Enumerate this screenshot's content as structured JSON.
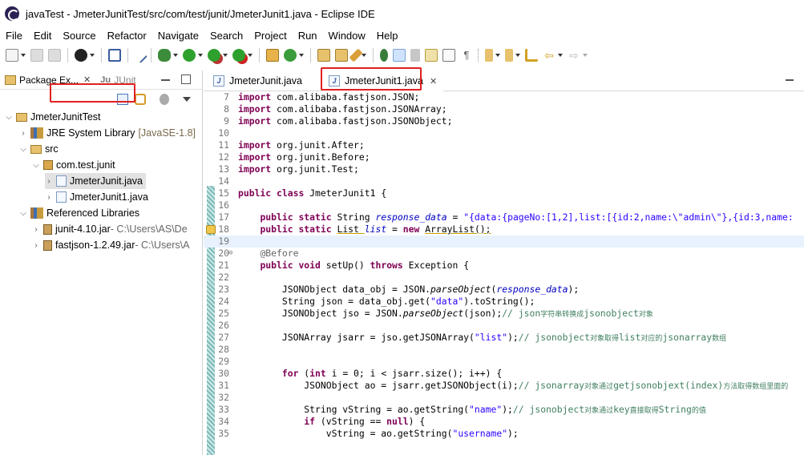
{
  "window": {
    "title": "javaTest - JmeterJunitTest/src/com/test/junit/JmeterJunit1.java - Eclipse IDE"
  },
  "menu": [
    "File",
    "Edit",
    "Source",
    "Refactor",
    "Navigate",
    "Search",
    "Project",
    "Run",
    "Window",
    "Help"
  ],
  "left_tabs": {
    "package_explorer": "Package Ex...",
    "junit": "JUnit"
  },
  "tree": {
    "project": "JmeterJunitTest",
    "jre": "JRE System Library",
    "jre_version": "[JavaSE-1.8]",
    "src": "src",
    "package": "com.test.junit",
    "file1": "JmeterJunit.java",
    "file2": "JmeterJunit1.java",
    "ref_libs": "Referenced Libraries",
    "lib1": "junit-4.10.jar",
    "lib1_path": " - C:\\Users\\AS\\De",
    "lib2": "fastjson-1.2.49.jar",
    "lib2_path": " - C:\\Users\\A"
  },
  "editor_tabs": [
    "JmeterJunit.java",
    "JmeterJunit1.java"
  ],
  "code_lines": [
    {
      "n": "7"
    },
    {
      "n": "8"
    },
    {
      "n": "9"
    },
    {
      "n": "10"
    },
    {
      "n": "11"
    },
    {
      "n": "12"
    },
    {
      "n": "13"
    },
    {
      "n": "14"
    },
    {
      "n": "15"
    },
    {
      "n": "16"
    },
    {
      "n": "17"
    },
    {
      "n": "18"
    },
    {
      "n": "19"
    },
    {
      "n": "20"
    },
    {
      "n": "21"
    },
    {
      "n": "22"
    },
    {
      "n": "23"
    },
    {
      "n": "24"
    },
    {
      "n": "25"
    },
    {
      "n": "26"
    },
    {
      "n": "27"
    },
    {
      "n": "28"
    },
    {
      "n": "29"
    },
    {
      "n": "30"
    },
    {
      "n": "31"
    },
    {
      "n": "32"
    },
    {
      "n": "33"
    },
    {
      "n": "34"
    },
    {
      "n": "35"
    }
  ],
  "code": {
    "import_json": "com.alibaba.fastjson.JSON;",
    "import_jsonarray": "com.alibaba.fastjson.JSONArray;",
    "import_jsonobject": "com.alibaba.fastjson.JSONObject;",
    "import_after": "org.junit.After;",
    "import_before": "org.junit.Before;",
    "import_test": "org.junit.Test;",
    "class_name": "JmeterJunit1 {",
    "field1_name": "response_data",
    "field1_value": "\"{data:{pageNo:[1,2],list:[{id:2,name:\\\"admin\\\"},{id:3,name:",
    "field2_name": "list",
    "field2_rest": " = ",
    "annotation": "@Before",
    "setup": "setUp() ",
    "setup_rest": " Exception {",
    "l23_a": "JSONObject data_obj = JSON.",
    "l23_m": "parseObject",
    "l23_b": "(",
    "l23_c": ");",
    "l24_a": "String json = data_obj.get(",
    "l24_s": "\"data\"",
    "l24_b": ").toString();",
    "l25_a": "JSONObject jso = JSON.",
    "l25_m": "parseObject",
    "l25_b": "(json);",
    "l25_c": "// json",
    "l25_cn": "字符串转换成",
    "l25_d": "jsonobject",
    "l25_cn2": "对象",
    "l27_a": "JSONArray jsarr = jso.getJSONArray(",
    "l27_s": "\"list\"",
    "l27_b": ");",
    "l27_c": "// jsonobject",
    "l27_cn": "对象取得",
    "l27_d": "list",
    "l27_cn2": "对应的",
    "l27_e": "jsonarray",
    "l27_cn3": "数组",
    "l30_a": " (",
    "l30_b": " i = 0; i < jsarr.size(); i++) {",
    "l31_a": "JSONObject ao = jsarr.getJSONObject(i);",
    "l31_c": "// jsonarray",
    "l31_cn": "对象通过",
    "l31_d": "getjsonobjext(index)",
    "l31_cn2": "方法取得数组里面的",
    "l33_a": "String vString = ao.getString(",
    "l33_s": "\"name\"",
    "l33_b": ");",
    "l33_c": "// jsonobject",
    "l33_cn": "对象通过",
    "l33_d": "key",
    "l33_cn2": "直接取得",
    "l33_e": "String",
    "l33_cn3": "的值",
    "l34_a": " (vString == ",
    "l34_b": ") {",
    "l35_a": "vString = ao.getString(",
    "l35_s": "\"username\"",
    "l35_b": ");"
  },
  "keywords": {
    "import": "import",
    "public": "public",
    "class": "class",
    "static": "static",
    "new": "new",
    "void": "void",
    "throws": "throws",
    "for": "for",
    "int": "int",
    "if": "if",
    "null": "null"
  },
  "types": {
    "string": "String ",
    "list": "List ",
    "arraylist": "ArrayList();"
  },
  "colors": {
    "keyword": "#7f0055",
    "string": "#2a00ff",
    "field": "#0000c0",
    "comment": "#3f7f5f",
    "highlight": "#e02020"
  }
}
